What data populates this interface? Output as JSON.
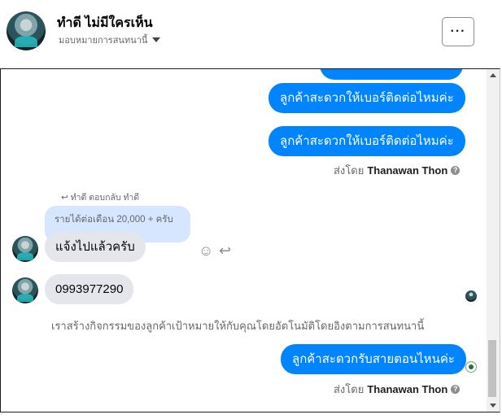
{
  "header": {
    "contact_name": "ทำดี ไม่มีใครเห็น",
    "assign_label": "มอบหมายการสนทนานี้",
    "more_label": "···"
  },
  "messages": {
    "out_1": "ลูกค้าสะดวกให้เบอร์ติดต่อไหมค่ะ",
    "out_2": "ลูกค้าสะดวกให้เบอร์ติดต่อไหมค่ะ",
    "sent_by_1_prefix": "ส่งโดย",
    "sent_by_1_name": "Thanawan Thon",
    "reply_label": "ทำดี ตอบกลับ ทำดี",
    "reply_quote": "รายได้ต่อเดือน 20,000 + ครับ",
    "in_1": "แจ้งไปแล้วครับ",
    "in_2": "0993977290",
    "system_note": "เราสร้างกิจกรรมของลูกค้าเป้าหมายให้กับคุณโดยอัตโนมัติโดยอิงตามการสนทนานี้",
    "out_3": "ลูกค้าสะดวกรับสายตอนไหนค่ะ",
    "sent_by_2_prefix": "ส่งโดย",
    "sent_by_2_name": "Thanawan Thon",
    "info_glyph": "?"
  },
  "actions": {
    "react_glyph": "☺",
    "reply_glyph": "↩"
  },
  "icons": {
    "more": "more-options-icon",
    "caret": "chevron-down-icon",
    "react": "smiley-icon",
    "reply": "reply-arrow-icon",
    "info": "info-icon",
    "seen": "seen-avatar-icon"
  },
  "colors": {
    "outgoing_bubble": "#0084ff",
    "incoming_bubble": "#e4e6eb",
    "reply_quote_bubble": "#d6e6ff"
  }
}
